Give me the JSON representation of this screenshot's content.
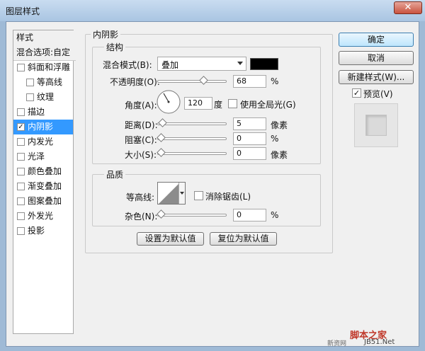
{
  "window": {
    "title": "图层样式",
    "close_glyph": "✕"
  },
  "left_panel": {
    "header": "样式",
    "blend_options": "混合选项:自定",
    "items": [
      {
        "label": "斜面和浮雕",
        "checked": false,
        "indent": false,
        "selected": false
      },
      {
        "label": "等高线",
        "checked": false,
        "indent": true,
        "selected": false
      },
      {
        "label": "纹理",
        "checked": false,
        "indent": true,
        "selected": false
      },
      {
        "label": "描边",
        "checked": false,
        "indent": false,
        "selected": false
      },
      {
        "label": "内阴影",
        "checked": true,
        "indent": false,
        "selected": true
      },
      {
        "label": "内发光",
        "checked": false,
        "indent": false,
        "selected": false
      },
      {
        "label": "光泽",
        "checked": false,
        "indent": false,
        "selected": false
      },
      {
        "label": "颜色叠加",
        "checked": false,
        "indent": false,
        "selected": false
      },
      {
        "label": "渐变叠加",
        "checked": false,
        "indent": false,
        "selected": false
      },
      {
        "label": "图案叠加",
        "checked": false,
        "indent": false,
        "selected": false
      },
      {
        "label": "外发光",
        "checked": false,
        "indent": false,
        "selected": false
      },
      {
        "label": "投影",
        "checked": false,
        "indent": false,
        "selected": false
      }
    ]
  },
  "inner_shadow": {
    "title": "内阴影",
    "structure": {
      "title": "结构",
      "blend_mode_label": "混合模式(B):",
      "blend_mode_value": "叠加",
      "color": "#000000",
      "opacity_label": "不透明度(O):",
      "opacity_value": "68",
      "opacity_unit": "%",
      "opacity_fraction": 0.68,
      "angle_label": "角度(A):",
      "angle_value": "120",
      "angle_unit": "度",
      "global_light_label": "使用全局光(G)",
      "global_light_checked": false,
      "distance_label": "距离(D):",
      "distance_value": "5",
      "distance_unit": "像素",
      "distance_fraction": 0.02,
      "choke_label": "阻塞(C):",
      "choke_value": "0",
      "choke_unit": "%",
      "choke_fraction": 0,
      "size_label": "大小(S):",
      "size_value": "0",
      "size_unit": "像素",
      "size_fraction": 0
    },
    "quality": {
      "title": "品质",
      "contour_label": "等高线:",
      "antialias_label": "消除锯齿(L)",
      "antialias_checked": false,
      "noise_label": "杂色(N):",
      "noise_value": "0",
      "noise_unit": "%",
      "noise_fraction": 0
    },
    "set_default_button": "设置为默认值",
    "reset_default_button": "复位为默认值"
  },
  "right_buttons": {
    "ok": "确定",
    "cancel": "取消",
    "new_style": "新建样式(W)...",
    "preview_label": "预览(V)",
    "preview_checked": true
  },
  "watermark": {
    "text1": "脚本之家",
    "text2": "JB51.Net",
    "text3": "新资网"
  }
}
